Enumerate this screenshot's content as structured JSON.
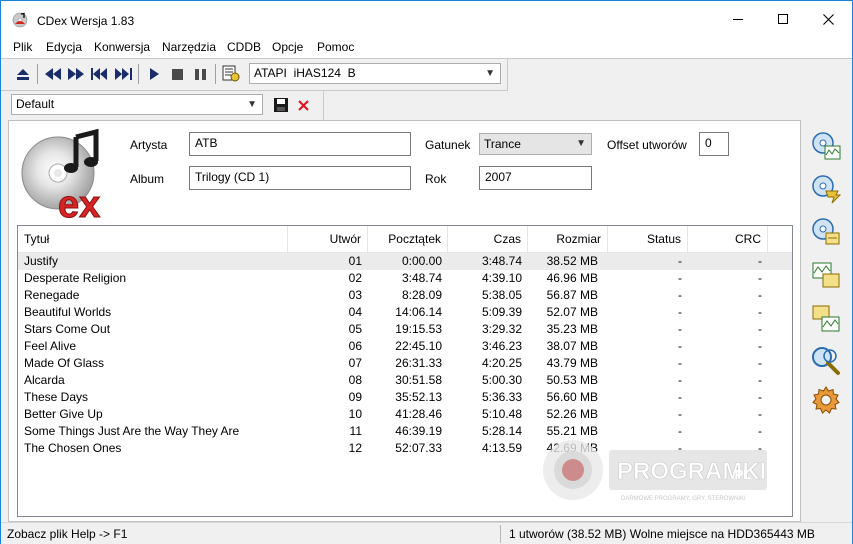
{
  "window": {
    "title": "CDex Wersja 1.83"
  },
  "menu": [
    "Plik",
    "Edycja",
    "Konwersja",
    "Narzędzia",
    "CDDB",
    "Opcje",
    "Pomoc"
  ],
  "toolbar": {
    "drive": "ATAPI  iHAS124  B",
    "profile": "Default"
  },
  "form": {
    "artist_label": "Artysta",
    "artist": "ATB",
    "album_label": "Album",
    "album": "Trilogy (CD 1)",
    "genre_label": "Gatunek",
    "genre": "Trance",
    "year_label": "Rok",
    "year": "2007",
    "offset_label": "Offset utworów",
    "offset": "0"
  },
  "table": {
    "columns": [
      "Tytuł",
      "Utwór",
      "Pocztątek",
      "Czas",
      "Rozmiar",
      "Status",
      "CRC"
    ],
    "rows": [
      [
        "Justify",
        "01",
        "0:00.00",
        "3:48.74",
        "38.52 MB",
        "-",
        "-"
      ],
      [
        "Desperate Religion",
        "02",
        "3:48.74",
        "4:39.10",
        "46.96 MB",
        "-",
        "-"
      ],
      [
        "Renegade",
        "03",
        "8:28.09",
        "5:38.05",
        "56.87 MB",
        "-",
        "-"
      ],
      [
        "Beautiful Worlds",
        "04",
        "14:06.14",
        "5:09.39",
        "52.07 MB",
        "-",
        "-"
      ],
      [
        "Stars Come Out",
        "05",
        "19:15.53",
        "3:29.32",
        "35.23 MB",
        "-",
        "-"
      ],
      [
        "Feel Alive",
        "06",
        "22:45.10",
        "3:46.23",
        "38.07 MB",
        "-",
        "-"
      ],
      [
        "Made Of Glass",
        "07",
        "26:31.33",
        "4:20.25",
        "43.79 MB",
        "-",
        "-"
      ],
      [
        "Alcarda",
        "08",
        "30:51.58",
        "5:00.30",
        "50.53 MB",
        "-",
        "-"
      ],
      [
        "These Days",
        "09",
        "35:52.13",
        "5:36.33",
        "56.60 MB",
        "-",
        "-"
      ],
      [
        "Better Give Up",
        "10",
        "41:28.46",
        "5:10.48",
        "52.26 MB",
        "-",
        "-"
      ],
      [
        "Some Things Just Are the Way They Are",
        "11",
        "46:39.19",
        "5:28.14",
        "55.21 MB",
        "-",
        "-"
      ],
      [
        "The Chosen Ones",
        "12",
        "52:07.33",
        "4:13.59",
        "42.69 MB",
        "-",
        "-"
      ]
    ]
  },
  "watermark": {
    "brand": "PROGRAMKI",
    "suffix": ".PL",
    "tagline": "DARMOWE PROGRAMY, GRY, STEROWNIKI"
  },
  "status": {
    "left": "Zobacz plik Help -> F1",
    "right": "1 utworów (38.52 MB) Wolne miejsce na HDD365443 MB"
  },
  "colors": {
    "titlebar_border": "#1883d7",
    "delete_x": "#e81123",
    "logo_red": "#d62424"
  }
}
